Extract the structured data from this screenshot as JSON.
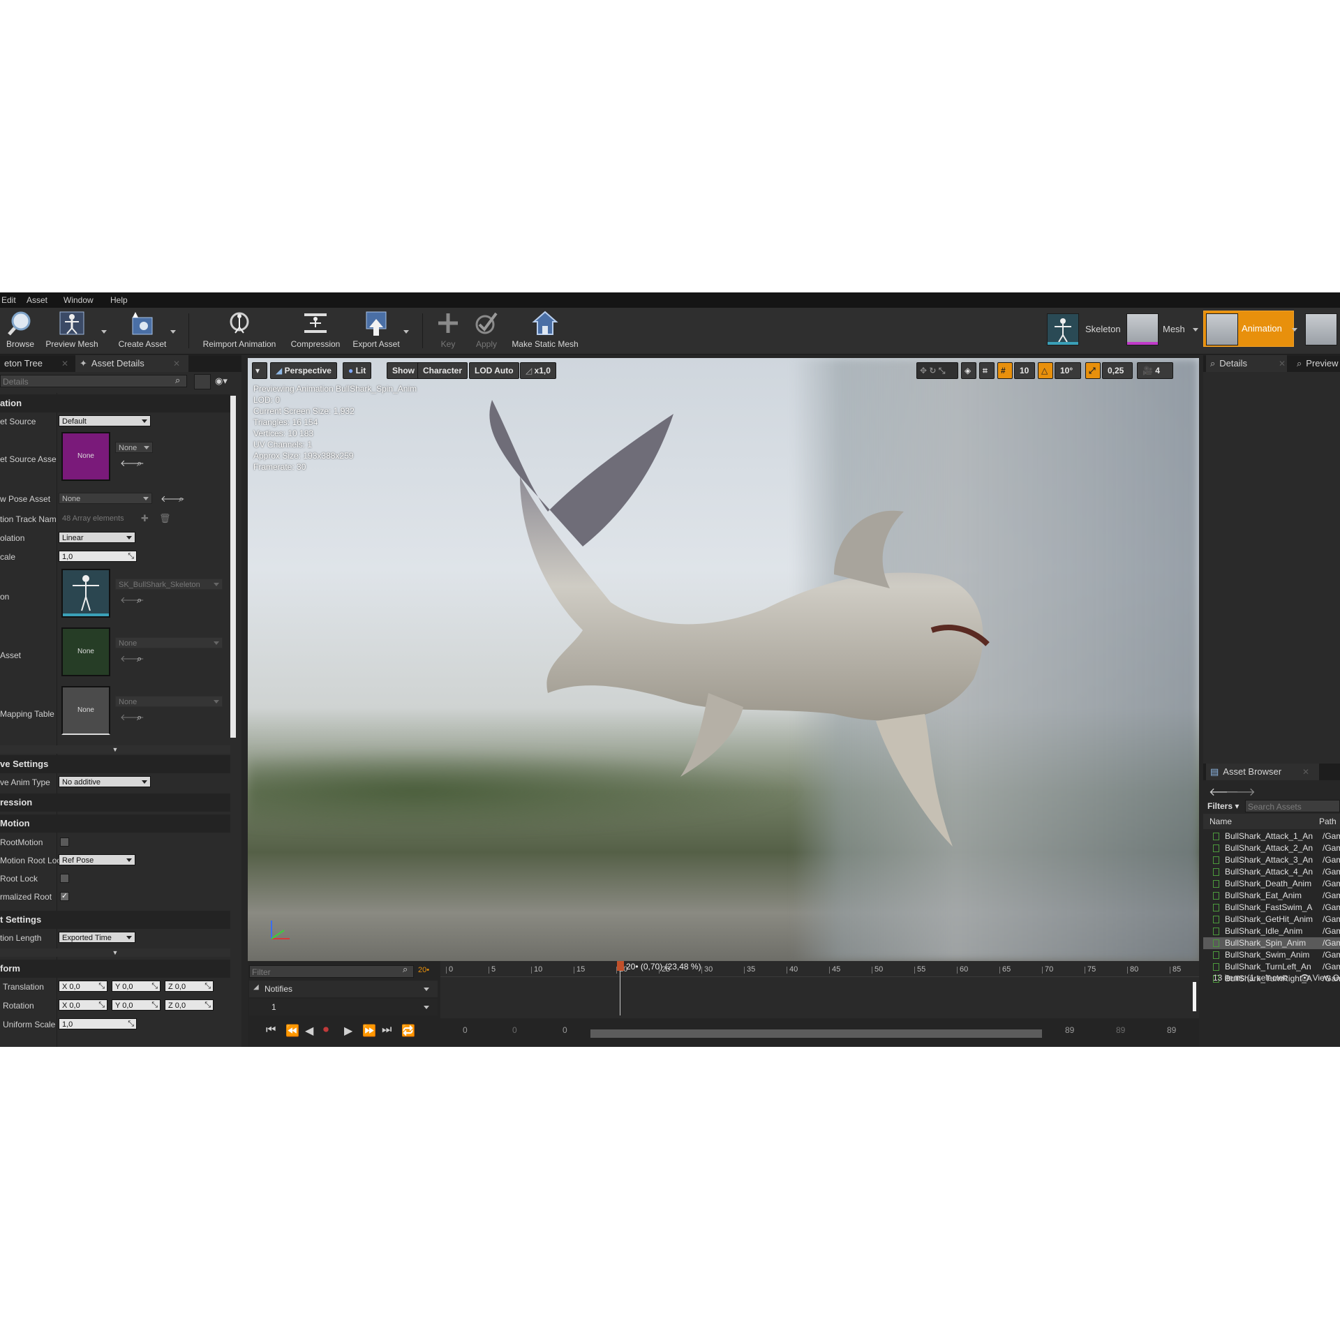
{
  "menu": [
    "Edit",
    "Asset",
    "Window",
    "Help"
  ],
  "toolbar": {
    "browse": "Browse",
    "preview_mesh": "Preview Mesh",
    "create_asset": "Create Asset",
    "reimport_animation": "Reimport Animation",
    "compression": "Compression",
    "export_asset": "Export Asset",
    "key": "Key",
    "apply": "Apply",
    "make_static_mesh": "Make Static Mesh"
  },
  "modes": {
    "skeleton": "Skeleton",
    "mesh": "Mesh",
    "animation": "Animation",
    "accent": "#e8900c"
  },
  "left_tabs": {
    "skeleton_tree": "eton Tree",
    "asset_details": "Asset Details"
  },
  "details_search_placeholder": "Details",
  "details": {
    "cat_animation": "ation",
    "target_source_label": "et Source",
    "target_source_value": "Default",
    "target_source_asset_label": "et Source Asse",
    "target_source_asset_thumb": "None",
    "target_source_asset_value": "None",
    "preview_pose_label": "w Pose Asset",
    "preview_pose_value": "None",
    "track_names_label": "tion Track Nam",
    "track_names_value": "48 Array elements",
    "interpolation_label": "olation",
    "interpolation_value": "Linear",
    "rate_scale_label": "cale",
    "rate_scale_value": "1,0",
    "skeleton_label": "on",
    "skeleton_value": "SK_BullShark_Skeleton",
    "asset_label": "Asset",
    "asset_thumb": "None",
    "asset_value": "None",
    "mapping_label": "Mapping Table",
    "mapping_thumb": "None",
    "mapping_value": "None",
    "cat_additive": "ve Settings",
    "additive_type_label": "ve Anim Type",
    "additive_type_value": "No additive",
    "cat_compression": "ression",
    "cat_root_motion": "Motion",
    "enable_root_motion_label": "RootMotion",
    "root_lock_label": "Motion Root Loc",
    "root_lock_value": "Ref Pose",
    "force_root_lock_label": "Root Lock",
    "normalized_root_label": "rmalized Root",
    "cat_import": "t Settings",
    "anim_length_label": "tion Length",
    "anim_length_value": "Exported Time",
    "cat_transform": "form",
    "translation_label": "Translation",
    "rotation_label": "Rotation",
    "uniform_scale_label": "Uniform Scale",
    "x_label": "X",
    "y_label": "Y",
    "z_label": "Z",
    "zero": "0,0",
    "scale_value": "1,0"
  },
  "viewport": {
    "perspective": "Perspective",
    "lit": "Lit",
    "show": "Show",
    "character": "Character",
    "lod": "LOD Auto",
    "speed": "x1,0",
    "grid": "10",
    "angle": "10°",
    "scale": "0,25",
    "camera_speed": "4",
    "info": [
      "Previewing Animation BullShark_Spin_Anim",
      "LOD: 0",
      "Current Screen Size: 1,932",
      "Triangles: 16 154",
      "Vertices: 10 183",
      "UV Channels: 1",
      "Approx Size: 193x388x259",
      "Framerate: 30"
    ]
  },
  "timeline": {
    "filter_placeholder": "Filter",
    "current_frame": "20•",
    "scrub_label": "20• (0,70) (23,48 %)",
    "ticks": [
      "0",
      "5",
      "10",
      "15",
      "20",
      "25",
      "30",
      "35",
      "40",
      "45",
      "50",
      "55",
      "60",
      "65",
      "70",
      "75",
      "80",
      "85"
    ],
    "notifies": "Notifies",
    "track_1": "1",
    "range_start": "0",
    "range_start2": "0",
    "range_start3": "0",
    "range_end": "89",
    "range_end2": "89",
    "range_end3": "89"
  },
  "right_tabs": {
    "details": "Details",
    "preview": "Preview"
  },
  "asset_browser": {
    "title": "Asset Browser",
    "filters": "Filters",
    "search_placeholder": "Search Assets",
    "col_name": "Name",
    "col_path": "Path",
    "items": [
      {
        "name": "BullShark_Attack_1_An",
        "path": "/Gam"
      },
      {
        "name": "BullShark_Attack_2_An",
        "path": "/Gam"
      },
      {
        "name": "BullShark_Attack_3_An",
        "path": "/Gam"
      },
      {
        "name": "BullShark_Attack_4_An",
        "path": "/Gam"
      },
      {
        "name": "BullShark_Death_Anim",
        "path": "/Gam"
      },
      {
        "name": "BullShark_Eat_Anim",
        "path": "/Gam"
      },
      {
        "name": "BullShark_FastSwim_A",
        "path": "/Gam"
      },
      {
        "name": "BullShark_GetHit_Anim",
        "path": "/Gam"
      },
      {
        "name": "BullShark_Idle_Anim",
        "path": "/Gam"
      },
      {
        "name": "BullShark_Spin_Anim",
        "path": "/Gam"
      },
      {
        "name": "BullShark_Swim_Anim",
        "path": "/Gam"
      },
      {
        "name": "BullShark_TurnLeft_An",
        "path": "/Gam"
      },
      {
        "name": "BullShark_TurnRight_A",
        "path": "/Gam"
      }
    ],
    "selected_index": 9,
    "status": "13 items (1 selectec",
    "view_options": "View O"
  }
}
